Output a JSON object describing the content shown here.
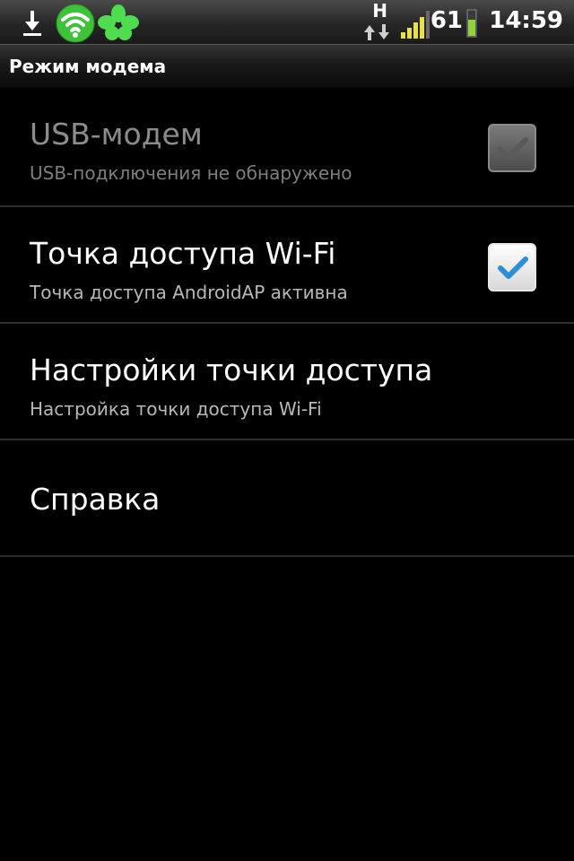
{
  "status_bar": {
    "icons_left": [
      "download-icon",
      "wifi-hotspot-icon",
      "clover-icon"
    ],
    "network_type": "H",
    "battery_level": "61",
    "time": "14:59",
    "colors": {
      "wifi_green": "#3ec23a",
      "clover_green": "#4fdc4f",
      "signal_yellow": "#e8e14a"
    }
  },
  "title_bar": {
    "title": "Режим модема"
  },
  "preferences": [
    {
      "title": "USB-модем",
      "summary": "USB-подключения не обнаружено",
      "checked": true,
      "enabled": false
    },
    {
      "title": "Точка доступа Wi-Fi",
      "summary": "Точка доступа AndroidAP активна",
      "checked": true,
      "enabled": true
    },
    {
      "title": "Настройки точки доступа",
      "summary": "Настройка точки доступа Wi-Fi"
    },
    {
      "title": "Справка"
    }
  ],
  "colors": {
    "check_blue": "#2a8fd6",
    "divider": "#2e2e2e"
  }
}
